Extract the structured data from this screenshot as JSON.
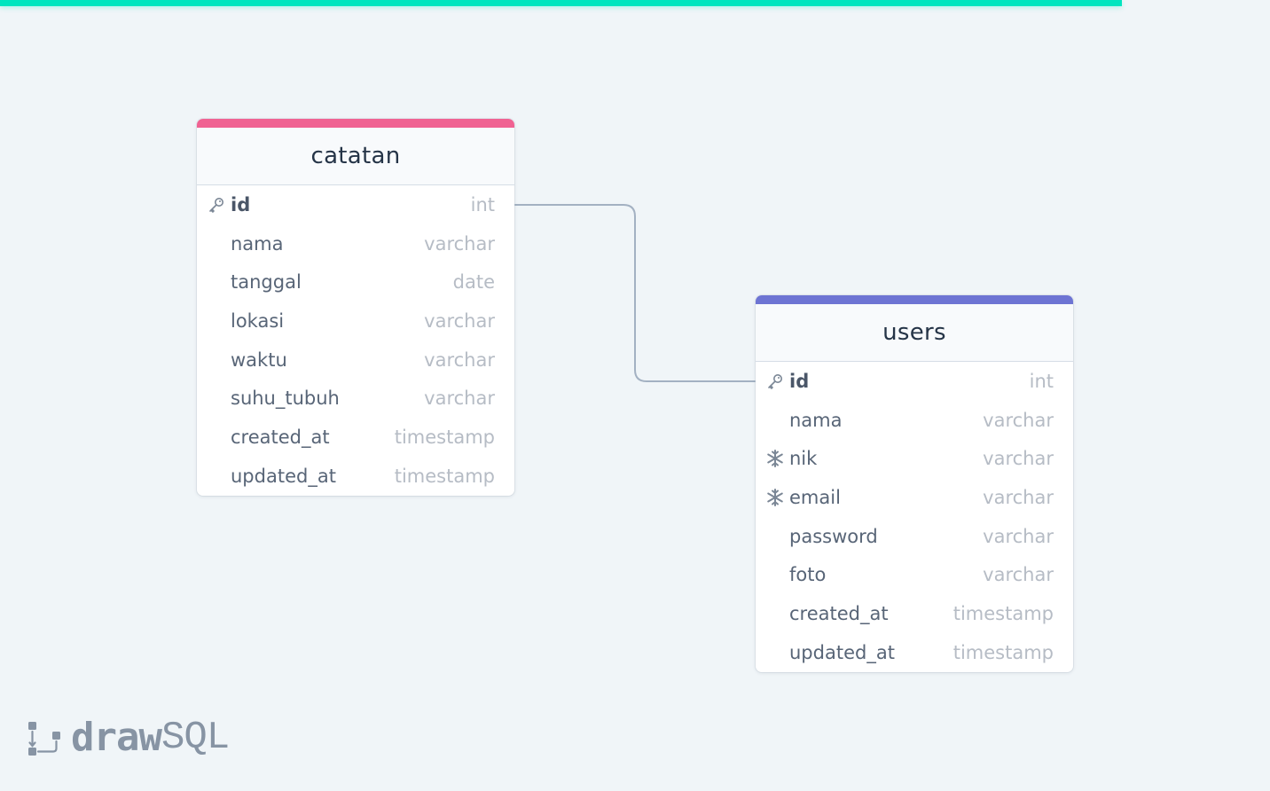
{
  "tables": [
    {
      "name": "catatan",
      "accent": "#f06292",
      "columns": [
        {
          "name": "id",
          "type": "int",
          "icon": "key-icon",
          "pk": true
        },
        {
          "name": "nama",
          "type": "varchar"
        },
        {
          "name": "tanggal",
          "type": "date"
        },
        {
          "name": "lokasi",
          "type": "varchar"
        },
        {
          "name": "waktu",
          "type": "varchar"
        },
        {
          "name": "suhu_tubuh",
          "type": "varchar"
        },
        {
          "name": "created_at",
          "type": "timestamp"
        },
        {
          "name": "updated_at",
          "type": "timestamp"
        }
      ]
    },
    {
      "name": "users",
      "accent": "#6d74d3",
      "columns": [
        {
          "name": "id",
          "type": "int",
          "icon": "key-icon",
          "pk": true
        },
        {
          "name": "nama",
          "type": "varchar"
        },
        {
          "name": "nik",
          "type": "varchar",
          "icon": "unique-snowflake-icon"
        },
        {
          "name": "email",
          "type": "varchar",
          "icon": "unique-snowflake-icon"
        },
        {
          "name": "password",
          "type": "varchar"
        },
        {
          "name": "foto",
          "type": "varchar"
        },
        {
          "name": "created_at",
          "type": "timestamp"
        },
        {
          "name": "updated_at",
          "type": "timestamp"
        }
      ]
    }
  ],
  "relations": [
    {
      "from": "catatan.id",
      "to": "users.id"
    }
  ],
  "branding": {
    "draw": "draw",
    "sql": "SQL"
  },
  "colors": {
    "top_bar": "#00e5bf",
    "background": "#f0f5f8",
    "connector": "#a3b1c2"
  }
}
